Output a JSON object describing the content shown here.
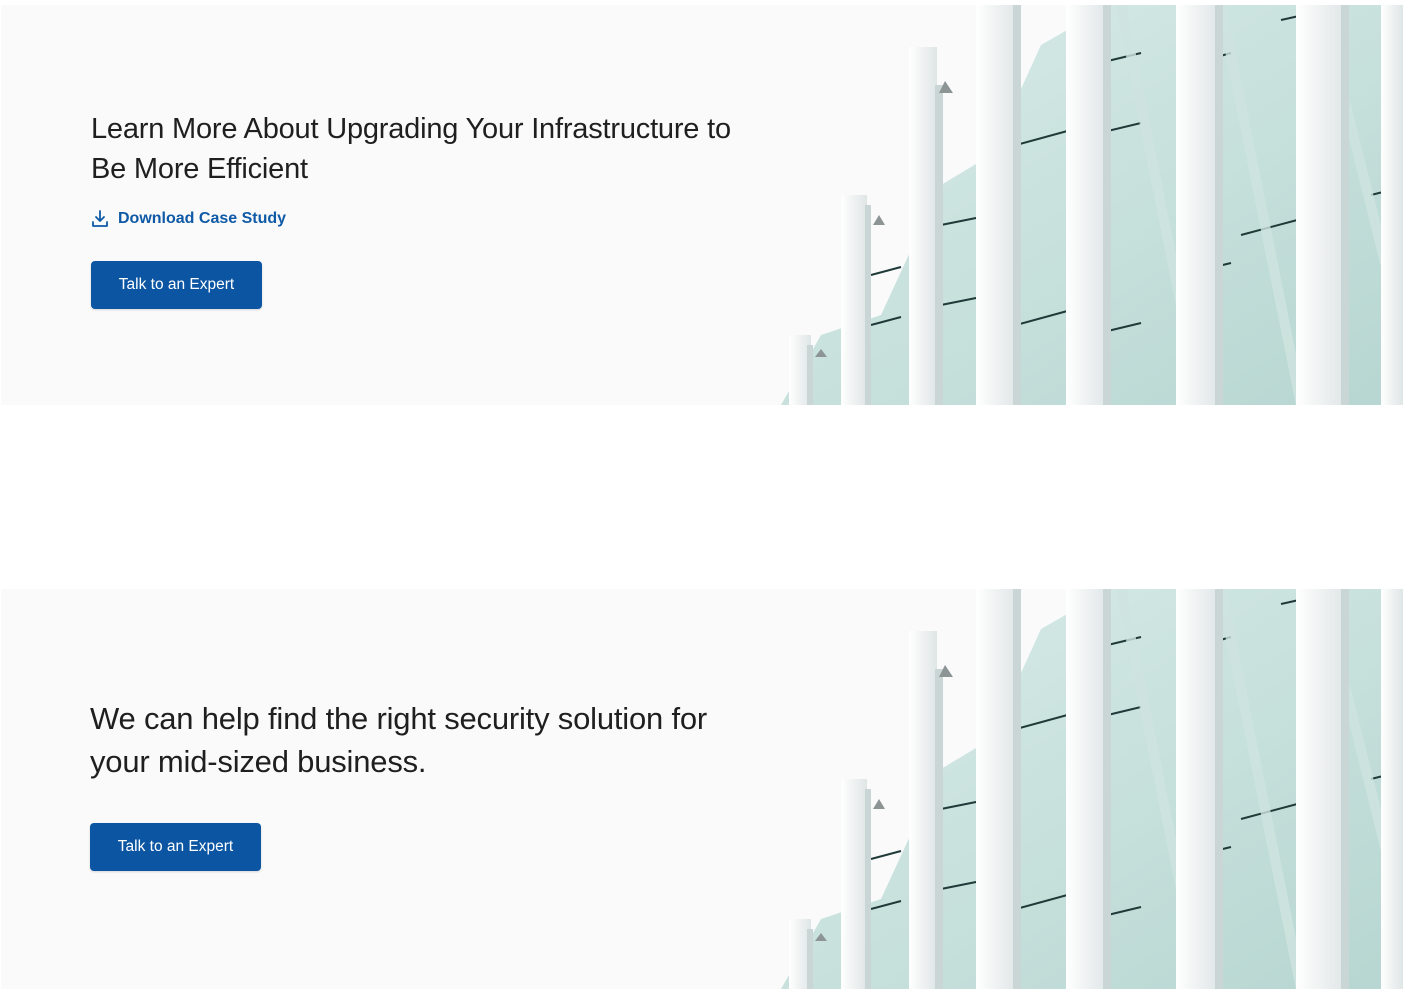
{
  "banners": [
    {
      "headline": "Learn More About Upgrading Your Infrastructure to Be More Efficient",
      "download_link": {
        "label": "Download Case Study",
        "icon": "download-icon"
      },
      "cta_label": "Talk to an Expert",
      "image": "glass-building-facade"
    },
    {
      "headline": "We can help find the right security solution for your mid-sized business.",
      "cta_label": "Talk to an Expert",
      "image": "glass-building-facade"
    }
  ],
  "colors": {
    "accent": "#0b55a3",
    "link": "#0f5aa6",
    "banner_bg": "#fafafb",
    "headline": "#1f1f1f"
  }
}
